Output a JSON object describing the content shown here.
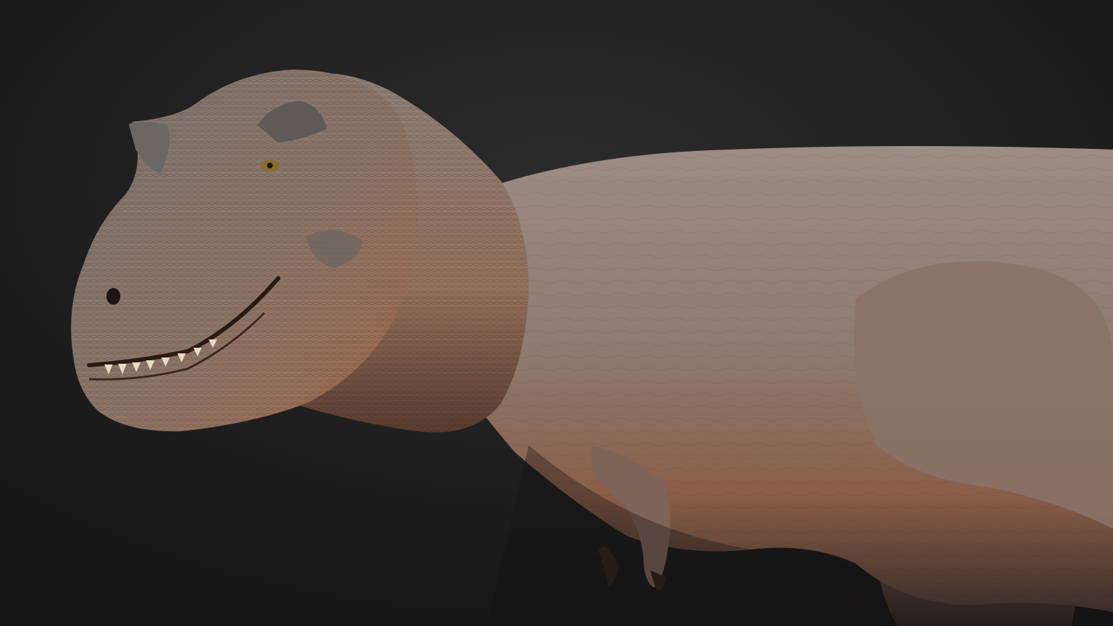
{
  "image": {
    "subject": "trex-render",
    "background_color": "#262626",
    "background_color_dark": "#161616",
    "skin_light": "#9c8a80",
    "skin_mid": "#7a6a62",
    "skin_warm": "#a0674a",
    "skin_dark": "#3e3530",
    "eye_color": "#8a6a2e",
    "teeth_color": "#e8dcc4"
  }
}
